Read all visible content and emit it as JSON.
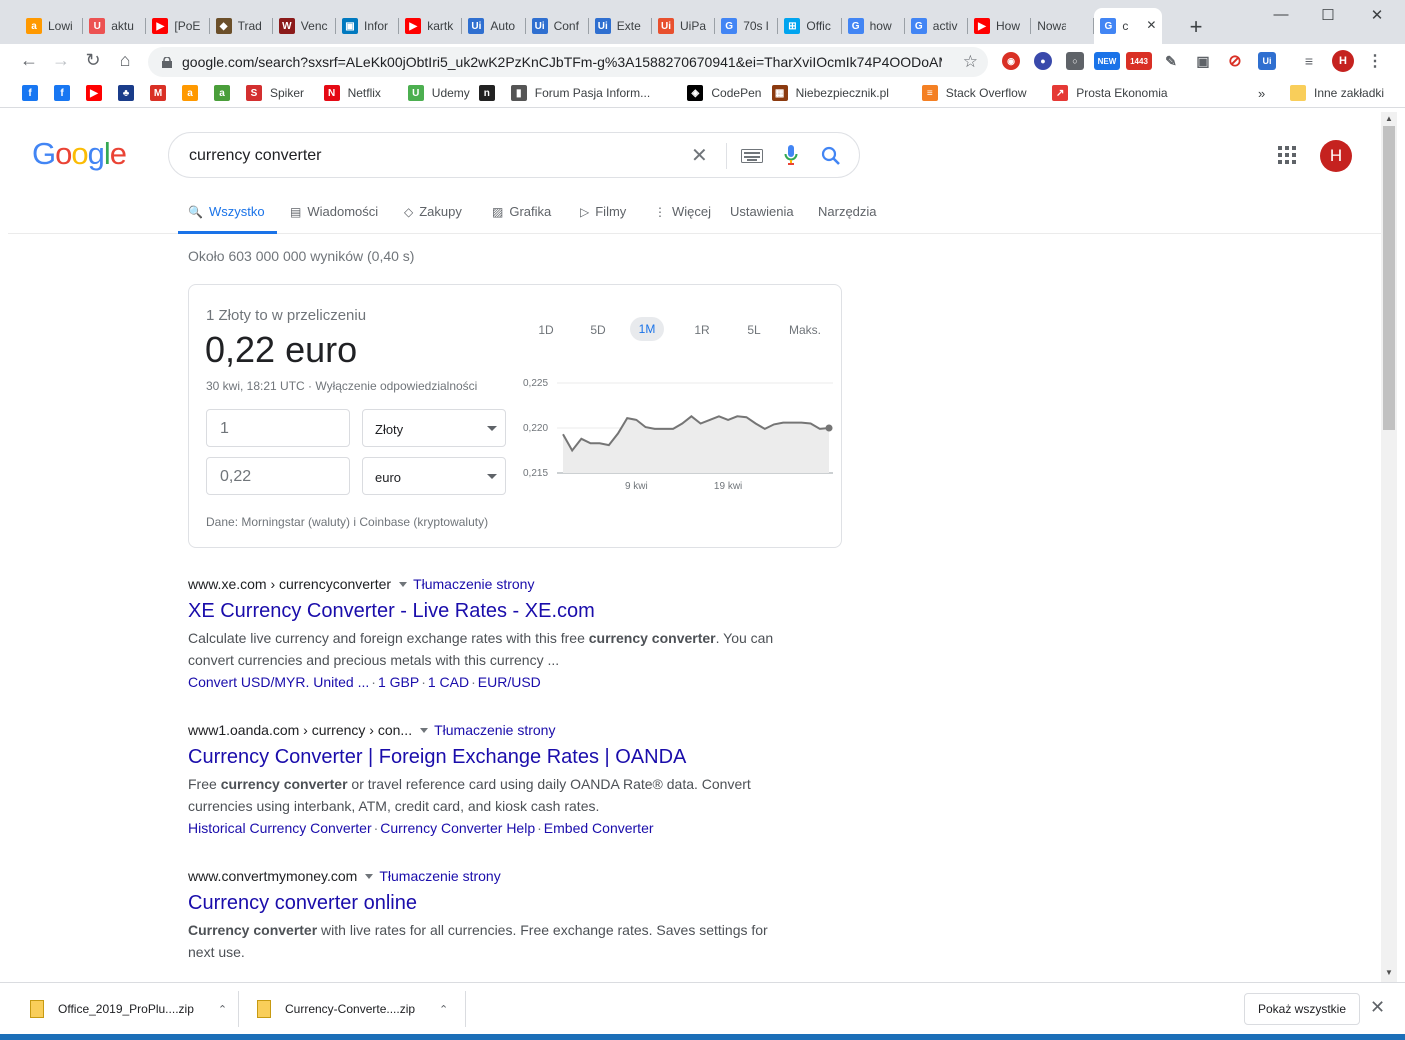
{
  "browser": {
    "tabs": [
      {
        "label": "Lowi",
        "icon": "amazon-icon",
        "color": "#ff9900",
        "glyph": "a"
      },
      {
        "label": "aktu",
        "icon": "udemy-icon",
        "color": "#ec5252",
        "glyph": "U"
      },
      {
        "label": "[PoE",
        "icon": "youtube-icon",
        "color": "#ff0000",
        "glyph": "▶"
      },
      {
        "label": "Trad",
        "icon": "trade-icon",
        "color": "#6b4f2a",
        "glyph": "◆"
      },
      {
        "label": "Venc",
        "icon": "wc-icon",
        "color": "#8b1a1a",
        "glyph": "W"
      },
      {
        "label": "Infor",
        "icon": "trello-icon",
        "color": "#0079bf",
        "glyph": "▣"
      },
      {
        "label": "kartk",
        "icon": "youtube-icon",
        "color": "#ff0000",
        "glyph": "▶"
      },
      {
        "label": "Auto",
        "icon": "uipath-icon",
        "color": "#2f6fd0",
        "glyph": "Ui"
      },
      {
        "label": "Conf",
        "icon": "uipath-icon",
        "color": "#2f6fd0",
        "glyph": "Ui"
      },
      {
        "label": "Exte",
        "icon": "uipath-icon",
        "color": "#2f6fd0",
        "glyph": "Ui"
      },
      {
        "label": "UiPa",
        "icon": "uipath-icon",
        "color": "#e8502e",
        "glyph": "Ui"
      },
      {
        "label": "70s l",
        "icon": "google-icon",
        "color": "#4285f4",
        "glyph": "G"
      },
      {
        "label": "Offic",
        "icon": "microsoft-icon",
        "color": "#00a4ef",
        "glyph": "⊞"
      },
      {
        "label": "how",
        "icon": "google-icon",
        "color": "#4285f4",
        "glyph": "G"
      },
      {
        "label": "activ",
        "icon": "google-icon",
        "color": "#4285f4",
        "glyph": "G"
      },
      {
        "label": "How",
        "icon": "youtube-icon",
        "color": "#ff0000",
        "glyph": "▶"
      },
      {
        "label": "Nowa ka",
        "icon": "",
        "color": "",
        "glyph": ""
      },
      {
        "label": "c",
        "icon": "google-icon",
        "color": "#4285f4",
        "glyph": "G",
        "active": true
      }
    ],
    "new_tab": "+",
    "url": "google.com/search?sxsrf=ALeKk00jObtIri5_uk2wK2PzKnCJbTFm-g%3A1588270670941&ei=TharXviIOcmIk74P4OODoAM...",
    "profile_initial": "H",
    "ext_badge": "1443",
    "ext_new": "NEW",
    "bookmarks": [
      {
        "label": "",
        "icon": "facebook-icon",
        "color": "#1877f2",
        "glyph": "f"
      },
      {
        "label": "",
        "icon": "facebook-icon",
        "color": "#1877f2",
        "glyph": "f"
      },
      {
        "label": "",
        "icon": "youtube-icon",
        "color": "#ff0000",
        "glyph": "▶"
      },
      {
        "label": "",
        "icon": "bank-icon",
        "color": "#1a3c8a",
        "glyph": "♣"
      },
      {
        "label": "",
        "icon": "gmail-icon",
        "color": "#d93025",
        "glyph": "M"
      },
      {
        "label": "",
        "icon": "amazon-icon",
        "color": "#ff9900",
        "glyph": "a"
      },
      {
        "label": "",
        "icon": "allegro-icon",
        "color": "#4a9e3a",
        "glyph": "a"
      },
      {
        "label": "Spiker",
        "icon": "superman-icon",
        "color": "#d32f2f",
        "glyph": "S"
      },
      {
        "label": "Netflix",
        "icon": "netflix-icon",
        "color": "#e50914",
        "glyph": "N"
      },
      {
        "label": "Udemy",
        "icon": "udemy-icon",
        "color": "#4caf50",
        "glyph": "U"
      },
      {
        "label": "",
        "icon": "terminal-icon",
        "color": "#222222",
        "glyph": "n"
      },
      {
        "label": "Forum Pasja Inform...",
        "icon": "forum-icon",
        "color": "#555555",
        "glyph": "▮"
      },
      {
        "label": "CodePen",
        "icon": "codepen-icon",
        "color": "#000000",
        "glyph": "◈"
      },
      {
        "label": "Niebezpiecznik.pl",
        "icon": "niebezpiecznik-icon",
        "color": "#8b3a0f",
        "glyph": "▦"
      },
      {
        "label": "Stack Overflow",
        "icon": "stackoverflow-icon",
        "color": "#f48024",
        "glyph": "≡"
      },
      {
        "label": "Prosta Ekonomia",
        "icon": "chart-icon",
        "color": "#e53935",
        "glyph": "↗"
      }
    ],
    "bookmarks_overflow": "»",
    "other_bookmarks": "Inne zakładki"
  },
  "google": {
    "query": "currency converter",
    "tabs": [
      {
        "label": "Wszystko",
        "icon": "search-icon",
        "glyph": "🔍"
      },
      {
        "label": "Wiadomości",
        "icon": "news-icon",
        "glyph": "▤"
      },
      {
        "label": "Zakupy",
        "icon": "tag-icon",
        "glyph": "◇"
      },
      {
        "label": "Grafika",
        "icon": "image-icon",
        "glyph": "▨"
      },
      {
        "label": "Filmy",
        "icon": "video-icon",
        "glyph": "▷"
      },
      {
        "label": "Więcej",
        "icon": "more-icon",
        "glyph": "⋮"
      },
      {
        "label": "Ustawienia",
        "icon": "",
        "glyph": ""
      },
      {
        "label": "Narzędzia",
        "icon": "",
        "glyph": ""
      }
    ],
    "stats": "Około 603 000 000 wyników (0,40 s)",
    "converter": {
      "lead": "1 Złoty to w przeliczeniu",
      "result": "0,22 euro",
      "time": "30 kwi, 18:21 UTC · Wyłączenie odpowiedzialności",
      "amount_from": "1",
      "currency_from": "Złoty",
      "amount_to": "0,22",
      "currency_to": "euro",
      "source": "Dane: Morningstar (waluty) i Coinbase (kryptowaluty)",
      "ranges": [
        "1D",
        "5D",
        "1M",
        "1R",
        "5L",
        "Maks."
      ],
      "active_range": "1M"
    },
    "results": [
      {
        "cite": "www.xe.com › currencyconverter",
        "translate": "Tłumaczenie strony",
        "title": "XE Currency Converter - Live Rates - XE.com",
        "snippet_before": "Calculate live currency and foreign exchange rates with this free ",
        "snippet_bold": "currency converter",
        "snippet_after": ". You can convert currencies and precious metals with this currency ...",
        "links": [
          "Convert USD/MYR. United ...",
          "1 GBP",
          "1 CAD",
          "EUR/USD"
        ]
      },
      {
        "cite": "www1.oanda.com › currency › con...",
        "translate": "Tłumaczenie strony",
        "title": "Currency Converter | Foreign Exchange Rates | OANDA",
        "snippet_before": "Free ",
        "snippet_bold": "currency converter",
        "snippet_after": " or travel reference card using daily OANDA Rate® data. Convert currencies using interbank, ATM, credit card, and kiosk cash rates.",
        "links": [
          "Historical Currency Converter",
          "Currency Converter Help",
          "Embed Converter"
        ]
      },
      {
        "cite": "www.convertmymoney.com",
        "translate": "Tłumaczenie strony",
        "title": "Currency converter online",
        "snippet_before": "",
        "snippet_bold": "Currency converter",
        "snippet_after": " with live rates for all currencies. Free exchange rates. Saves settings for next use.",
        "links": []
      }
    ]
  },
  "chart_data": {
    "type": "line",
    "x_ticks": [
      "9 kwi",
      "19 kwi"
    ],
    "y_ticks": [
      "0,225",
      "0,220",
      "0,215"
    ],
    "ylim": [
      0.215,
      0.225
    ],
    "baseline": 0.215,
    "series": [
      {
        "values": [
          0.2193,
          0.2175,
          0.2188,
          0.2183,
          0.2183,
          0.2181,
          0.2194,
          0.2211,
          0.2209,
          0.2201,
          0.2199,
          0.2199,
          0.2199,
          0.2205,
          0.2213,
          0.2205,
          0.2209,
          0.2213,
          0.2209,
          0.2213,
          0.2212,
          0.2205,
          0.2199,
          0.2204,
          0.2206,
          0.2206,
          0.2206,
          0.2205,
          0.2199,
          0.22
        ]
      }
    ]
  },
  "downloads": {
    "items": [
      "Office_2019_ProPlu....zip",
      "Currency-Converte....zip"
    ],
    "show_all": "Pokaż wszystkie"
  }
}
